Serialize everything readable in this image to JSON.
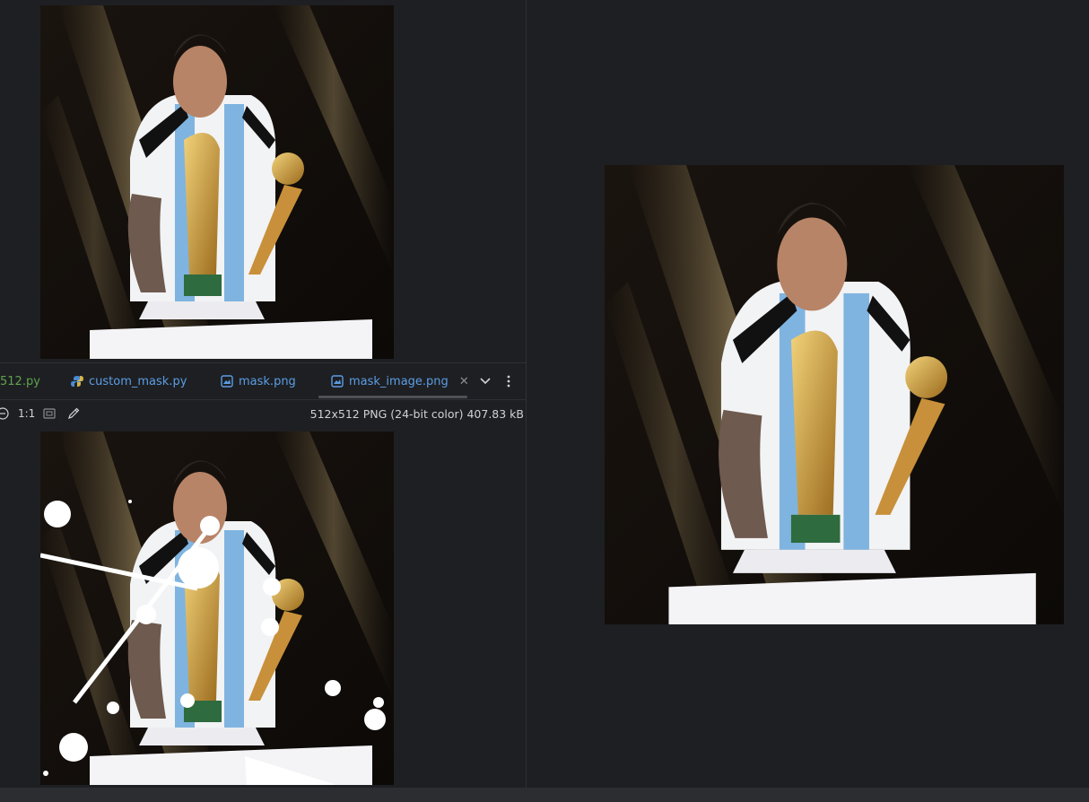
{
  "tabs": [
    {
      "label": "512.py",
      "icon": "python-file-icon",
      "color": "#5ea34f"
    },
    {
      "label": "custom_mask.py",
      "icon": "python-file-icon",
      "color": "#5a9ee6"
    },
    {
      "label": "mask.png",
      "icon": "image-file-icon",
      "color": "#5a9ee6"
    },
    {
      "label": "mask_image.png",
      "icon": "image-file-icon",
      "color": "#5a9ee6",
      "active": true
    }
  ],
  "toolbar": {
    "zoom_label": "1:1",
    "image_info": "512x512 PNG (24-bit color) 407.83 kB"
  },
  "icons": {
    "zoom_out": "zoom-out-icon",
    "fit": "fit-to-window-icon",
    "picker": "color-picker-icon",
    "chevron": "chevron-down-icon",
    "more": "more-vertical-icon",
    "close": "close-icon"
  },
  "colors": {
    "background": "#1e1f22",
    "tab_text": "#5a9ee6",
    "py_tab_text": "#5ea34f",
    "text": "#cfd1d5"
  }
}
